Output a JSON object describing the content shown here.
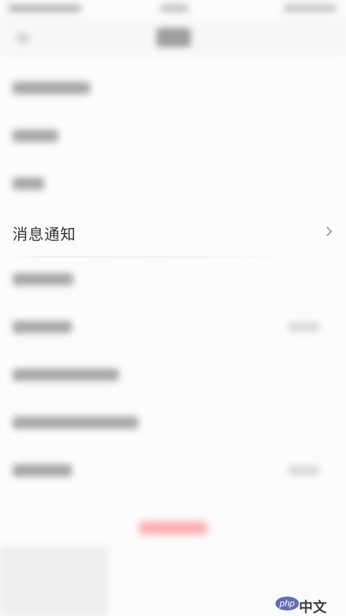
{
  "settings": {
    "items": [
      {
        "label": "消息通知"
      }
    ]
  },
  "watermark": {
    "logo": "php",
    "text": "中文网"
  },
  "colors": {
    "background": "#fcfcfc",
    "label_text": "#333333",
    "chevron": "#9e9e9e",
    "logout_red": "#ff6b6b",
    "watermark_blue": "#5f6fb3"
  },
  "icons": [
    "chevron-right-icon",
    "back-arrow-icon"
  ]
}
